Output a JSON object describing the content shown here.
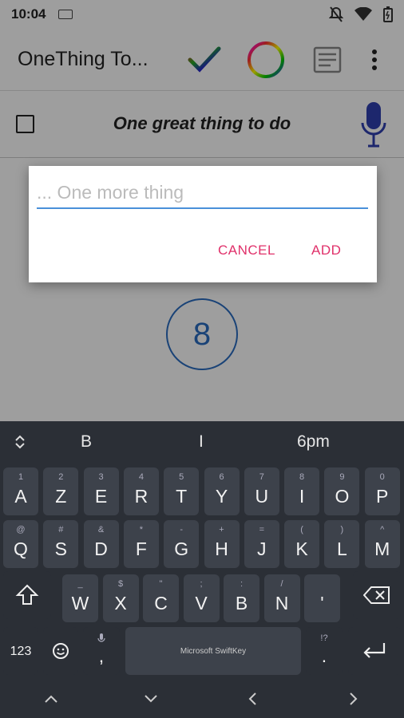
{
  "status": {
    "time": "10:04"
  },
  "appbar": {
    "title": "OneThing To..."
  },
  "task": {
    "text": "One great thing to do"
  },
  "counter": {
    "value": "8"
  },
  "dialog": {
    "placeholder": "... One more thing",
    "cancel_label": "CANCEL",
    "add_label": "ADD"
  },
  "keyboard": {
    "suggestions": [
      "B",
      "I",
      "6pm"
    ],
    "row1": [
      {
        "k": "A",
        "h": "1"
      },
      {
        "k": "Z",
        "h": "2"
      },
      {
        "k": "E",
        "h": "3"
      },
      {
        "k": "R",
        "h": "4"
      },
      {
        "k": "T",
        "h": "5"
      },
      {
        "k": "Y",
        "h": "6"
      },
      {
        "k": "U",
        "h": "7"
      },
      {
        "k": "I",
        "h": "8"
      },
      {
        "k": "O",
        "h": "9"
      },
      {
        "k": "P",
        "h": "0"
      }
    ],
    "row2": [
      {
        "k": "Q",
        "h": "@"
      },
      {
        "k": "S",
        "h": "#"
      },
      {
        "k": "D",
        "h": "&"
      },
      {
        "k": "F",
        "h": "*"
      },
      {
        "k": "G",
        "h": "-"
      },
      {
        "k": "H",
        "h": "+"
      },
      {
        "k": "J",
        "h": "="
      },
      {
        "k": "K",
        "h": "("
      },
      {
        "k": "L",
        "h": ")"
      },
      {
        "k": "M",
        "h": "^"
      }
    ],
    "row3": [
      {
        "k": "W",
        "h": "_"
      },
      {
        "k": "X",
        "h": "$"
      },
      {
        "k": "C",
        "h": "\""
      },
      {
        "k": "V",
        "h": ";"
      },
      {
        "k": "B",
        "h": ":"
      },
      {
        "k": "N",
        "h": "/"
      },
      {
        "k": "'",
        "h": ""
      }
    ],
    "numbers_label": "123",
    "comma": ",",
    "period": ".",
    "space_label": "Microsoft SwiftKey"
  },
  "colors": {
    "accent": "#e0306a",
    "underline": "#4a90d9",
    "counter": "#2a6cc0",
    "keyboard_bg": "#2b2f36",
    "key_bg": "#3d424b"
  }
}
